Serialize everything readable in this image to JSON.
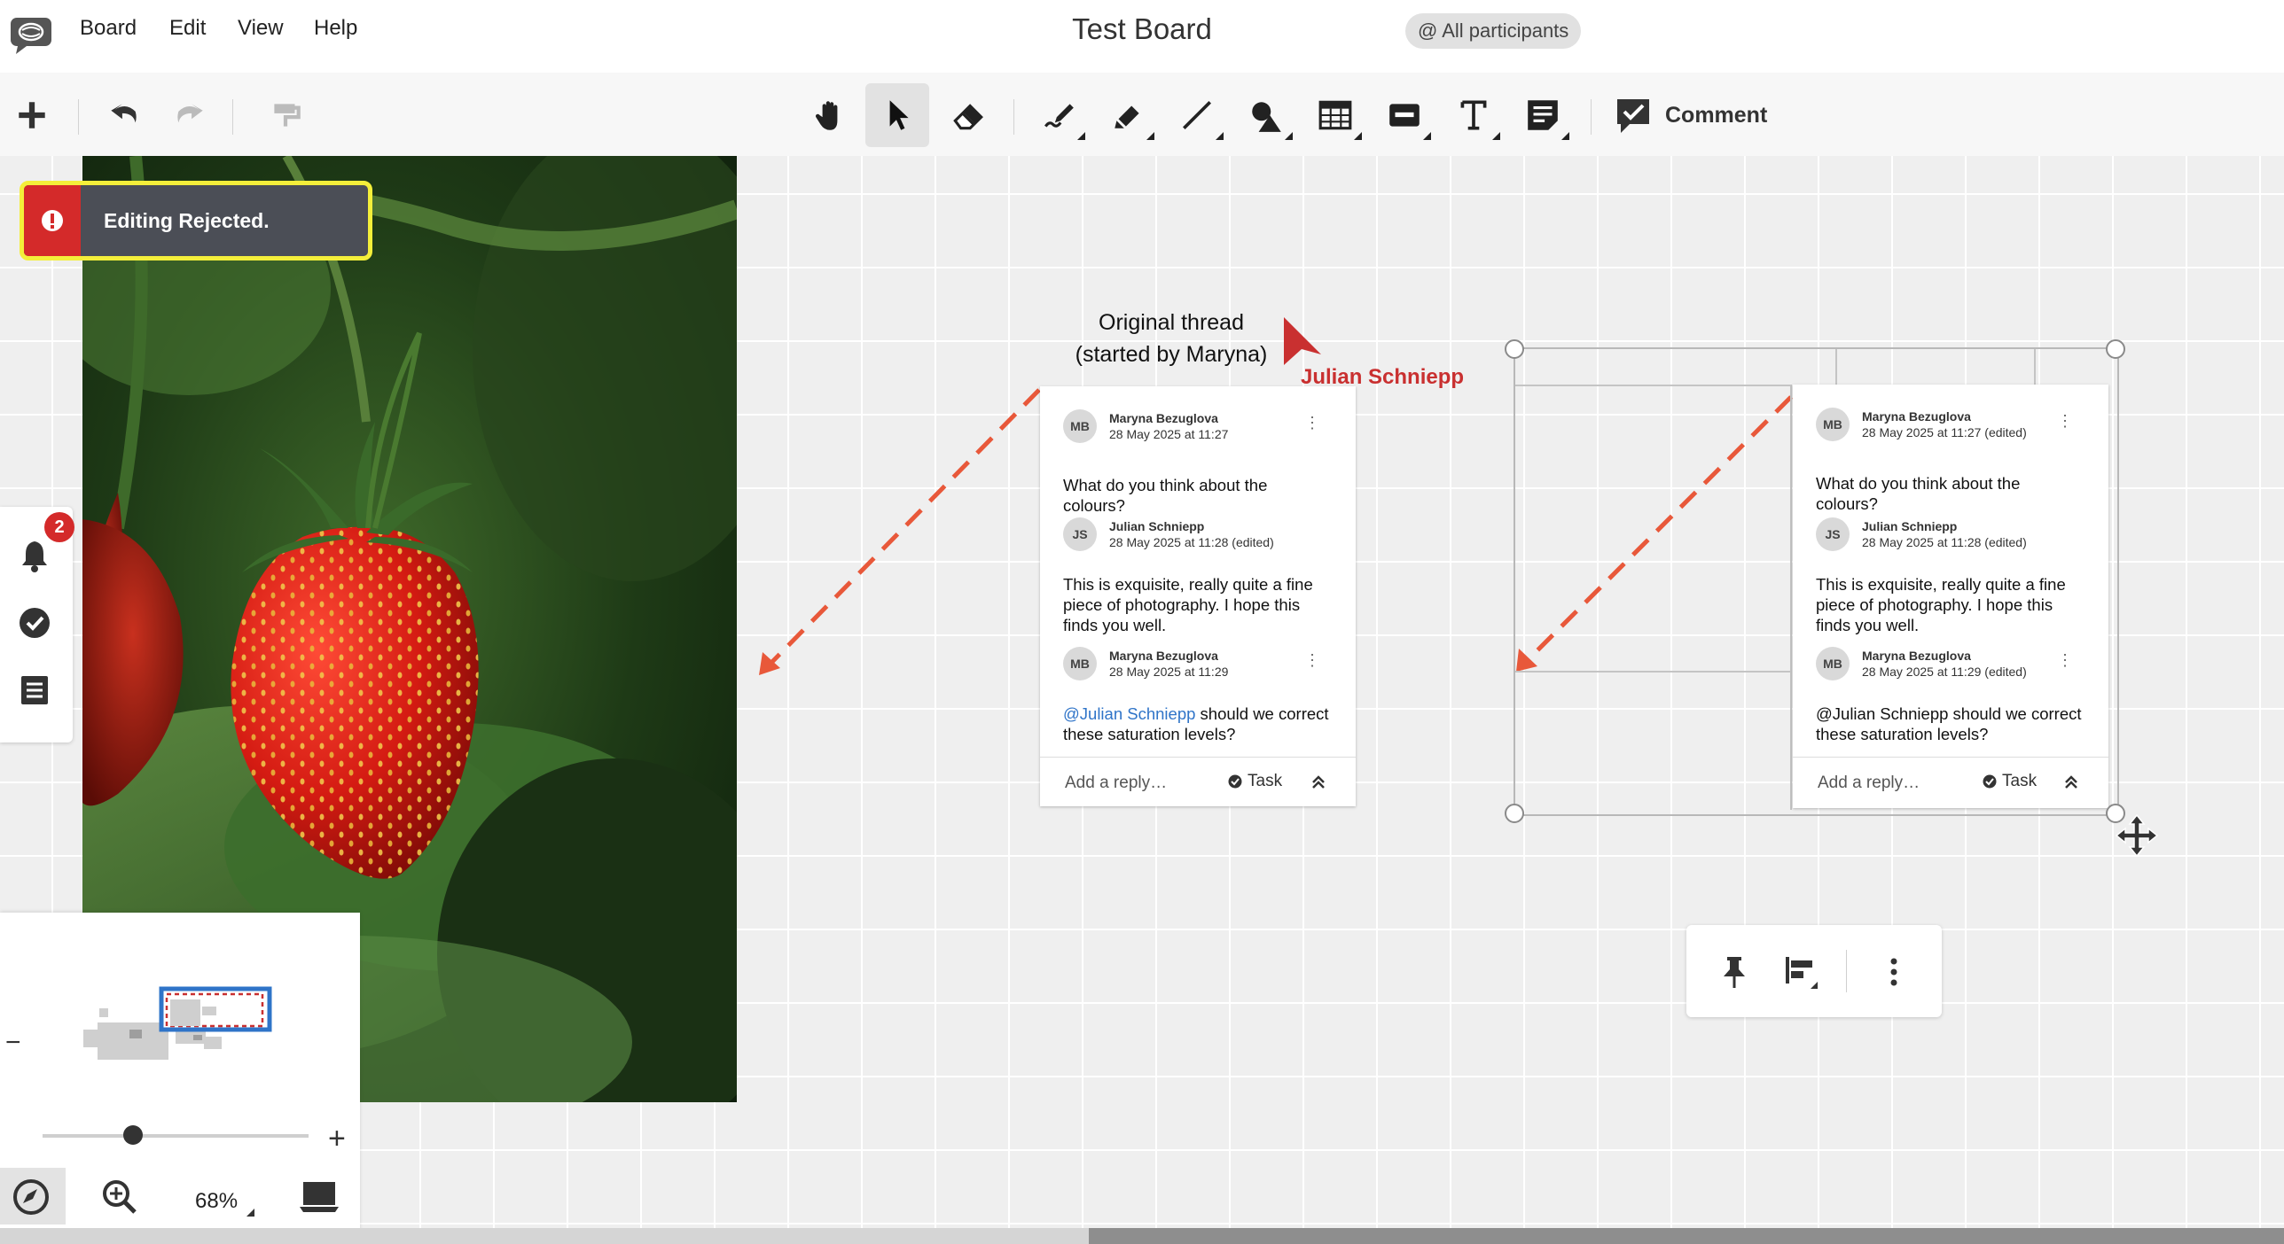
{
  "app": {
    "logo_icon": "speech-bubble-logo-icon"
  },
  "menu": {
    "items": [
      "Board",
      "Edit",
      "View",
      "Help"
    ]
  },
  "board": {
    "title": "Test Board",
    "participants_label": "@ All participants"
  },
  "toolbar": {
    "add_icon": "plus-icon",
    "undo_icon": "undo-icon",
    "redo_icon": "redo-icon",
    "format_painter_icon": "paint-roller-icon",
    "tools": [
      "hand-icon",
      "pointer-icon",
      "eraser-icon",
      "pen-icon",
      "highlighter-icon",
      "line-icon",
      "shapes-icon",
      "table-icon",
      "sticky-note-icon",
      "text-icon",
      "note-icon"
    ],
    "active_tool": "pointer-icon",
    "comment_label": "Comment"
  },
  "toast": {
    "message": "Editing Rejected.",
    "type": "error",
    "color": "#d42a2a"
  },
  "left_panel": {
    "notification_count": "2",
    "icons": [
      "bell-icon",
      "check-circle-icon",
      "list-icon"
    ]
  },
  "annotations": {
    "original_label": "Original thread\n(started by Maryna)",
    "remote_cursor_name": "Julian Schniepp",
    "remote_cursor_color": "#c93030"
  },
  "thread_left": {
    "comments": [
      {
        "initials": "MB",
        "author": "Maryna Bezuglova",
        "time": "28 May 2025 at 11:27",
        "text": "What do you think about the colours?"
      },
      {
        "initials": "JS",
        "author": "Julian Schniepp",
        "time": "28 May 2025 at 11:28 (edited)",
        "text": "This is exquisite, really quite a fine piece of photography. I hope this finds you well."
      },
      {
        "initials": "MB",
        "author": "Maryna Bezuglova",
        "time": "28 May 2025 at 11:29",
        "mention": "@Julian Schniepp",
        "text": " should we correct these saturation levels?"
      }
    ],
    "reply_placeholder": "Add a reply…",
    "task_label": "Task"
  },
  "thread_right": {
    "comments": [
      {
        "initials": "MB",
        "author": "Maryna Bezuglova",
        "time": "28 May 2025 at 11:27 (edited)",
        "text": "What do you think about the colours?"
      },
      {
        "initials": "JS",
        "author": "Julian Schniepp",
        "time": "28 May 2025 at 11:28 (edited)",
        "text": "This is exquisite, really quite a fine piece of photography. I hope this finds you well."
      },
      {
        "initials": "MB",
        "author": "Maryna Bezuglova",
        "time": "28 May 2025 at 11:29 (edited)",
        "text": "@Julian Schniepp should we correct these saturation levels?"
      }
    ],
    "reply_placeholder": "Add a reply…",
    "task_label": "Task"
  },
  "object_toolbar": {
    "icons": [
      "pin-icon",
      "align-icon",
      "more-vertical-icon"
    ]
  },
  "minimap": {
    "zoom_out_label": "−",
    "zoom_in_label": "+",
    "zoom_level": "68%",
    "zoom_fraction": 0.68,
    "icons": [
      "compass-icon",
      "zoom-fit-icon",
      "presentation-icon"
    ]
  },
  "colors": {
    "dashed_arrow": "#e8583a",
    "selection_border": "#b8b8b8",
    "highlight": "#f4ef3a"
  }
}
